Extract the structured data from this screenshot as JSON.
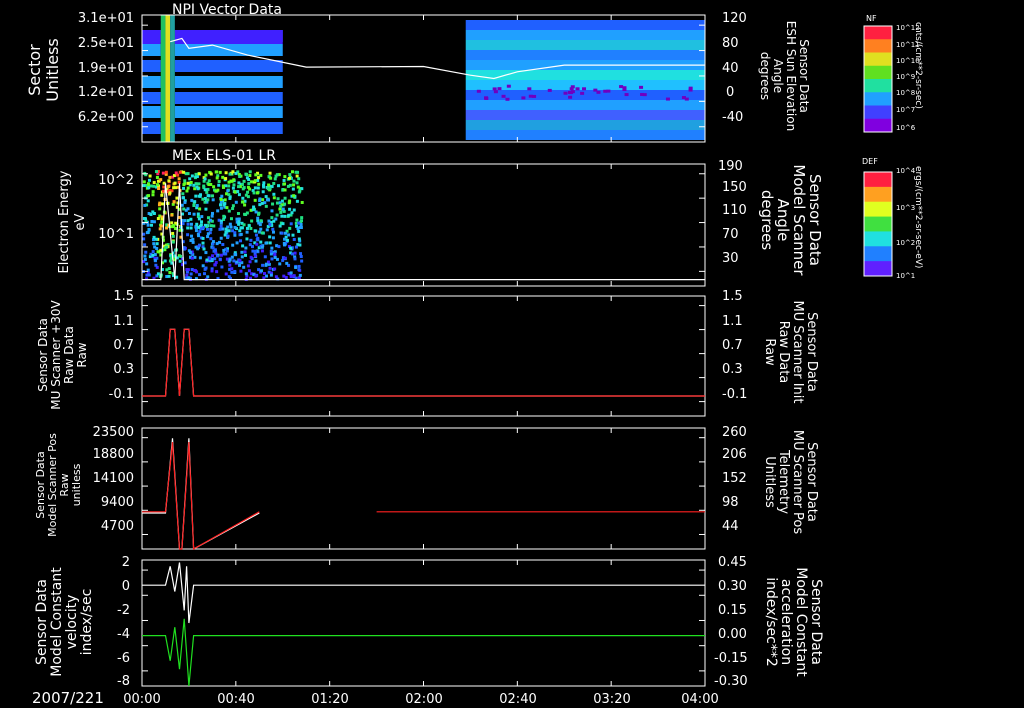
{
  "date_label": "2007/221",
  "time_ticks": [
    "00:00",
    "00:40",
    "01:20",
    "02:00",
    "02:40",
    "03:20",
    "04:00"
  ],
  "colors": {
    "white": "#ffffff",
    "red": "#ff2020",
    "green": "#20e020"
  },
  "colorbars": [
    {
      "title": "NF",
      "unit": "cnts/(cm**2-sr-sec)",
      "ticks": [
        "10^12",
        "10^11",
        "10^10",
        "10^9",
        "10^8",
        "10^7",
        "10^6"
      ]
    },
    {
      "title": "DEF",
      "unit": "ergs/(cm**2-sr-sec-eV)",
      "ticks": [
        "10^4",
        "10^3",
        "10^2",
        "10^1"
      ]
    }
  ],
  "panels": [
    {
      "title": "NPI Vector Data",
      "left_label": [
        "Sector",
        "Unitless"
      ],
      "right_label": [
        "Sensor Data",
        "ESH Sun Elevation",
        "Angle",
        "degrees"
      ],
      "left_ticks": [
        "3.1e+01",
        "2.5e+01",
        "1.9e+01",
        "1.2e+01",
        "6.2e+00"
      ],
      "right_ticks": [
        "120",
        "80",
        "40",
        "0",
        "-40"
      ]
    },
    {
      "title": "MEx ELS-01 LR",
      "left_label": [
        "Electron Energy",
        "eV"
      ],
      "right_label": [
        "Sensor Data",
        "Model Scanner",
        "Angle",
        "degrees"
      ],
      "left_ticks": [
        "10^2",
        "10^1"
      ],
      "right_ticks": [
        "190",
        "150",
        "110",
        "70",
        "30"
      ]
    },
    {
      "title": "",
      "left_label": [
        "Sensor Data",
        "MU Scanner +30V",
        "Raw Data",
        "Raw"
      ],
      "right_label": [
        "Sensor Data",
        "MU Scanner Init",
        "Raw Data",
        "Raw"
      ],
      "left_ticks": [
        "1.5",
        "1.1",
        "0.7",
        "0.3",
        "-0.1"
      ],
      "right_ticks": [
        "1.5",
        "1.1",
        "0.7",
        "0.3",
        "-0.1"
      ]
    },
    {
      "title": "",
      "left_label": [
        "Sensor Data",
        "Model Scanner Pos",
        "Raw",
        "unitless"
      ],
      "right_label": [
        "Sensor Data",
        "MU Scanner Pos",
        "Telemetry",
        "Unitless"
      ],
      "left_ticks": [
        "23500",
        "18800",
        "14100",
        "9400",
        "4700"
      ],
      "right_ticks": [
        "260",
        "206",
        "152",
        "98",
        "44"
      ]
    },
    {
      "title": "",
      "left_label": [
        "Sensor Data",
        "Model Constant",
        "velocity",
        "index/sec"
      ],
      "right_label": [
        "Sensor Data",
        "Model Constant",
        "acceleration",
        "index/sec**2"
      ],
      "left_ticks": [
        "2",
        "0",
        "-2",
        "-4",
        "-6",
        "-8"
      ],
      "right_ticks": [
        "0.45",
        "0.30",
        "0.15",
        "0.00",
        "-0.15",
        "-0.30"
      ]
    }
  ],
  "chart_data": [
    {
      "type": "heatmap",
      "title": "NPI Vector Data",
      "x_range": [
        "00:00",
        "04:00"
      ],
      "ylabel": "Sector Unitless",
      "y2label": "Sensor Data ESH Sun Elevation Angle degrees",
      "y2lim": [
        -70,
        120
      ],
      "line_series": {
        "name": "ESH Sun Elevation",
        "x_min": [
          12,
          17,
          20,
          30,
          45,
          70,
          120,
          140,
          150,
          160,
          180,
          240
        ],
        "y": [
          80,
          85,
          70,
          75,
          60,
          42,
          43,
          30,
          25,
          35,
          45,
          45
        ]
      }
    },
    {
      "type": "heatmap",
      "title": "MEx ELS-01 LR",
      "x_range": [
        "00:00",
        "04:00"
      ],
      "ylabel": "Electron Energy eV",
      "ylog": true,
      "y2label": "Sensor Data Model Scanner Angle degrees",
      "y2lim": [
        10,
        190
      ],
      "line_series": {
        "name": "Model Scanner Angle",
        "x_min": [
          0,
          8,
          10,
          14,
          16,
          18,
          20,
          24,
          50,
          240
        ],
        "y": [
          10,
          10,
          160,
          10,
          160,
          10,
          10,
          10,
          10,
          10
        ]
      }
    },
    {
      "type": "line",
      "x_range": [
        "00:00",
        "04:00"
      ],
      "ylim": [
        -0.3,
        1.5
      ],
      "series": [
        {
          "name": "MU Scanner +30V Raw Data",
          "x_min": [
            0,
            10,
            12,
            14,
            16,
            18,
            20,
            22,
            240
          ],
          "y": [
            0,
            0,
            1,
            1,
            0,
            1,
            1,
            0,
            0
          ]
        },
        {
          "name": "MU Scanner Init Raw Data",
          "x_min": [
            0,
            10,
            12,
            14,
            16,
            18,
            20,
            22,
            240
          ],
          "y": [
            0,
            0,
            1,
            1,
            0,
            1,
            1,
            0,
            0
          ]
        }
      ]
    },
    {
      "type": "line",
      "x_range": [
        "00:00",
        "04:00"
      ],
      "ylim": [
        0,
        23500
      ],
      "y2lim": [
        0,
        260
      ],
      "series": [
        {
          "name": "Model Scanner Pos Raw",
          "x_min": [
            0,
            10,
            13,
            16,
            17,
            20,
            22,
            50
          ],
          "y": [
            7000,
            7000,
            21500,
            0,
            0,
            21500,
            0,
            7000
          ]
        },
        {
          "name": "MU Scanner Pos Telemetry",
          "x_min": [
            0,
            10,
            13,
            16,
            17,
            20,
            22,
            50,
            100,
            240
          ],
          "y": [
            80,
            80,
            230,
            0,
            0,
            230,
            0,
            80,
            80,
            80
          ]
        }
      ]
    },
    {
      "type": "line",
      "x_range": [
        "00:00",
        "04:00"
      ],
      "ylim": [
        -8,
        2
      ],
      "y2lim": [
        -0.3,
        0.45
      ],
      "series": [
        {
          "name": "Model Constant velocity",
          "x_min": [
            0,
            10,
            12,
            14,
            16,
            18,
            19,
            20,
            22,
            240
          ],
          "y": [
            0,
            0,
            1.5,
            -0.5,
            1.8,
            -2,
            1.5,
            -3,
            0,
            0
          ]
        },
        {
          "name": "Model Constant acceleration",
          "x_min": [
            0,
            10,
            12,
            14,
            16,
            18,
            20,
            22,
            240
          ],
          "y": [
            0,
            0,
            -0.15,
            0.05,
            -0.2,
            0.1,
            -0.3,
            0,
            0
          ]
        }
      ]
    }
  ]
}
